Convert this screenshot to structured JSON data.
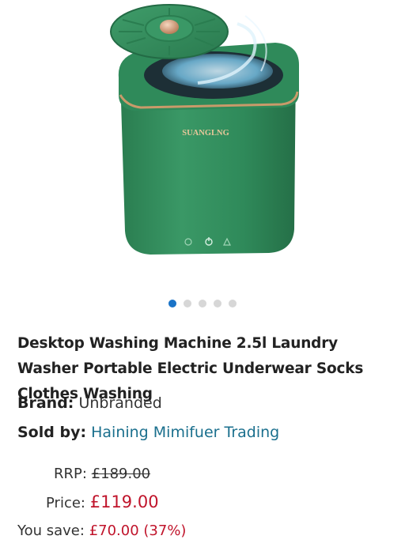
{
  "product_image": {
    "brand_mark": "SUANGLNG",
    "color": "#2f8a5a"
  },
  "carousel": {
    "count": 5,
    "active_index": 0,
    "active_color": "#1a73c7"
  },
  "product": {
    "title": "Desktop Washing Machine 2.5l Laundry Washer Portable Electric Underwear Socks Clothes Washing",
    "brand_label": "Brand:",
    "brand_value": "Unbranded",
    "seller_label": "Sold by:",
    "seller_value": "Haining Mimifuer Trading"
  },
  "pricing": {
    "rrp_label": "RRP:",
    "rrp_value": "£189.00",
    "price_label": "Price:",
    "price_value": "£119.00",
    "save_label": "You save:",
    "save_value": "£70.00 (37%)",
    "price_color": "#c0142b"
  }
}
